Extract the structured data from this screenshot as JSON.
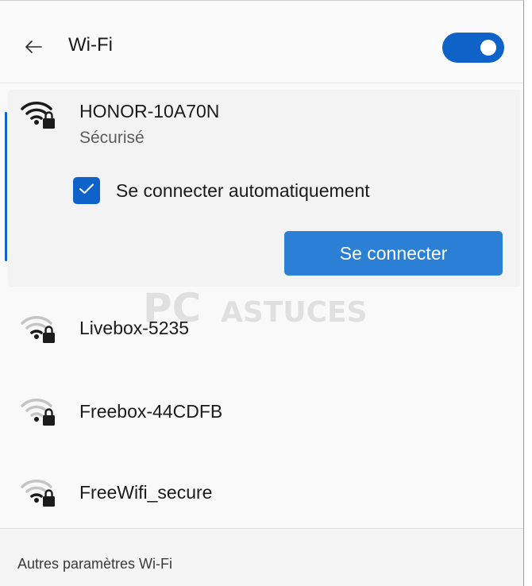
{
  "header": {
    "back_icon": "arrow-left-icon",
    "title": "Wi-Fi",
    "toggle_state": "on"
  },
  "selected_network": {
    "name": "HONOR-10A70N",
    "status": "Sécurisé",
    "signal": "full",
    "secured": true,
    "auto_connect_label": "Se connecter automatiquement",
    "auto_connect_checked": true,
    "connect_button_label": "Se connecter"
  },
  "networks": [
    {
      "name": "Livebox-5235",
      "signal": "low",
      "secured": true
    },
    {
      "name": "Freebox-44CDFB",
      "signal": "low",
      "secured": true
    },
    {
      "name": "FreeWifi_secure",
      "signal": "low",
      "secured": true
    }
  ],
  "footer": {
    "link_label": "Autres paramètres Wi-Fi"
  },
  "watermark": {
    "text_left": "PC",
    "text_right": "ASTUCES"
  },
  "colors": {
    "accent": "#0f63c8",
    "button": "#2b7fd4",
    "panel_bg": "#f9f9f9",
    "selected_bg": "#f3f3f3"
  }
}
